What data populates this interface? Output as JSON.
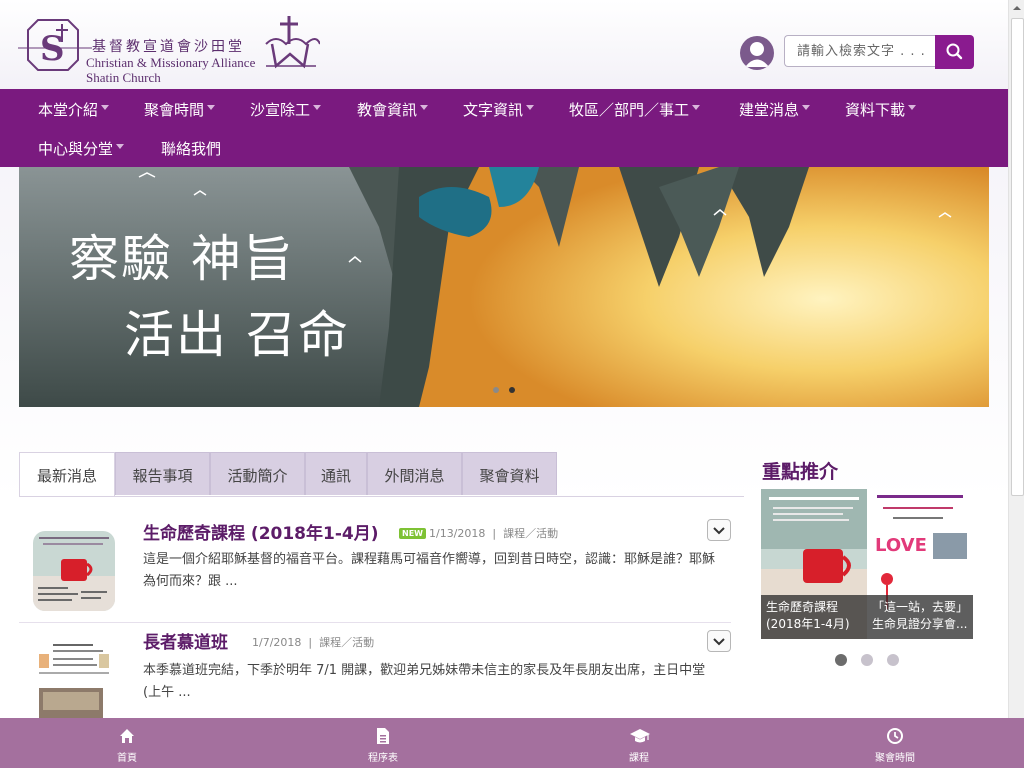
{
  "header": {
    "logo_cn": "基督教宣道會沙田堂",
    "logo_en_line1": "Christian & Missionary Alliance",
    "logo_en_line2": "Shatin Church",
    "search_placeholder": "請輸入檢索文字 . . ."
  },
  "nav": {
    "items": [
      {
        "label": "本堂介紹",
        "dropdown": true
      },
      {
        "label": "聚會時間",
        "dropdown": true
      },
      {
        "label": "沙宣除工",
        "dropdown": true
      },
      {
        "label": "教會資訊",
        "dropdown": true
      },
      {
        "label": "文字資訊",
        "dropdown": true
      },
      {
        "label": "牧區／部門／事工",
        "dropdown": true
      },
      {
        "label": "建堂消息",
        "dropdown": true
      },
      {
        "label": "資料下載",
        "dropdown": true
      },
      {
        "label": "中心與分堂",
        "dropdown": true
      },
      {
        "label": "聯絡我們",
        "dropdown": false
      }
    ]
  },
  "banner": {
    "line1": "察驗 神旨",
    "line2": "活出 召命",
    "slide_count": 2,
    "active_slide": 2
  },
  "tabs": [
    "最新消息",
    "報告事項",
    "活動簡介",
    "通訊",
    "外間消息",
    "聚會資料"
  ],
  "active_tab": 0,
  "news": [
    {
      "title": "生命歷奇課程 (2018年1-4月)",
      "badge": "NEW",
      "date": "1/13/2018",
      "category": "課程／活動",
      "desc": "這是一個介紹耶穌基督的福音平台。課程藉馬可福音作嚮導，回到昔日時空，認識：耶穌是誰？耶穌為何而來？跟 ..."
    },
    {
      "title": "長者慕道班",
      "badge": "",
      "date": "1/7/2018",
      "category": "課程／活動",
      "desc": "本季慕道班完結，下季於明年 7/1 開課，歡迎弟兄姊妹帶未信主的家長及年長朋友出席，主日中堂(上午 ..."
    }
  ],
  "featured": {
    "title": "重點推介",
    "cards": [
      {
        "caption": "生命歷奇課程 (2018年1-4月)"
      },
      {
        "caption": "「這一站，去要」生命見證分享會..."
      }
    ],
    "dot_count": 3,
    "active_dot": 0
  },
  "bottom_bar": [
    {
      "label": "首頁",
      "icon": "home-icon"
    },
    {
      "label": "程序表",
      "icon": "document-icon"
    },
    {
      "label": "課程",
      "icon": "graduation-cap-icon"
    },
    {
      "label": "聚會時間",
      "icon": "clock-icon"
    }
  ],
  "colors": {
    "nav_bg": "#7a1a7f",
    "accent_purple": "#5c1c68",
    "search_btn": "#8a1b8f",
    "bottom_bar_bg": "#a4709e",
    "tab_inactive": "#d8cfe2"
  }
}
